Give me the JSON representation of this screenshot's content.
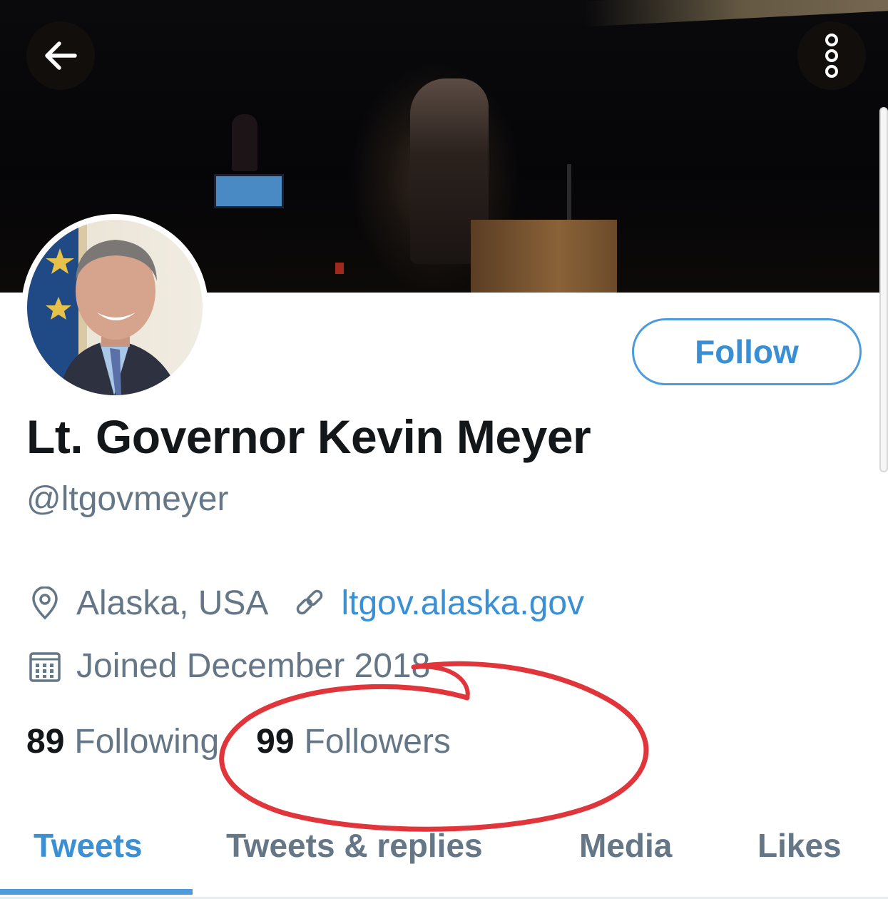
{
  "header": {
    "back_icon": "arrow-left-icon",
    "more_icon": "vertical-dots-icon"
  },
  "profile": {
    "follow_label": "Follow",
    "display_name": "Lt. Governor Kevin Meyer",
    "handle": "@ltgovmeyer",
    "location": "Alaska, USA",
    "website": "ltgov.alaska.gov",
    "joined": "Joined December 2018",
    "following_count": "89",
    "following_label": "Following",
    "followers_count": "99",
    "followers_label": "Followers"
  },
  "tabs": [
    {
      "label": "Tweets",
      "active": true
    },
    {
      "label": "Tweets & replies",
      "active": false
    },
    {
      "label": "Media",
      "active": false
    },
    {
      "label": "Likes",
      "active": false
    }
  ],
  "colors": {
    "accent": "#4b9bdd",
    "text_primary": "#14171a",
    "text_secondary": "#657786",
    "annotation": "#e0353a"
  }
}
